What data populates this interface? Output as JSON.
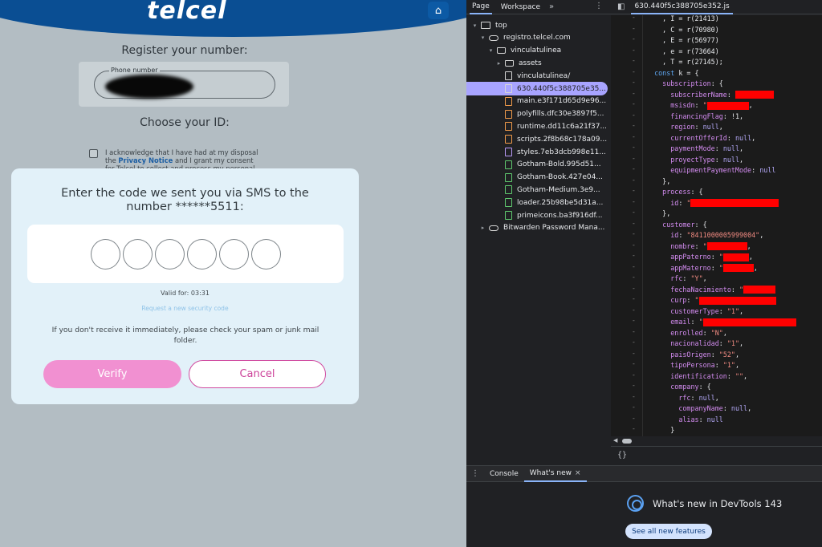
{
  "site": {
    "logo": "telcel",
    "home_icon": "home-icon",
    "register_title": "Register your number:",
    "phone_label": "Phone number",
    "choose_id": "Choose your ID:",
    "consent_pre": "I acknowledge that I have had at my disposal the ",
    "consent_link": "Privacy Notice",
    "consent_post": " and I grant my consent for Telcel to collect and process my personal data",
    "modal": {
      "title": "Enter the code we sent you via SMS to the number ******5511:",
      "digits": [
        "",
        "",
        "",
        "",
        "",
        ""
      ],
      "valid_for": "Valid for: 03:31",
      "request_link": "Request a new security code",
      "spam_note": "If you don't receive it immediately, please check your spam or junk mail folder.",
      "verify_label": "Verify",
      "cancel_label": "Cancel"
    }
  },
  "devtools": {
    "nav_tabs": [
      "Page",
      "Workspace"
    ],
    "nav_more": "»",
    "file_tree": [
      {
        "label": "top",
        "icon": "frame-icon",
        "arrow": "▾",
        "indent": 0
      },
      {
        "label": "registro.telcel.com",
        "icon": "cloud-icon",
        "arrow": "▾",
        "indent": 1
      },
      {
        "label": "vinculatulinea",
        "icon": "folder-icon",
        "arrow": "▾",
        "indent": 2
      },
      {
        "label": "assets",
        "icon": "folder-icon",
        "arrow": "▸",
        "indent": 3
      },
      {
        "label": "vinculatulinea/",
        "icon": "file-icon",
        "arrow": "",
        "indent": 3
      },
      {
        "label": "630.440f5c388705e35...",
        "icon": "file-icon",
        "arrow": "",
        "indent": 3,
        "selected": true
      },
      {
        "label": "main.e3f171d65d9e96...",
        "icon": "js-file-icon",
        "arrow": "",
        "indent": 3
      },
      {
        "label": "polyfills.dfc30e3897f5...",
        "icon": "js-file-icon",
        "arrow": "",
        "indent": 3
      },
      {
        "label": "runtime.dd11c6a21f37...",
        "icon": "js-file-icon",
        "arrow": "",
        "indent": 3
      },
      {
        "label": "scripts.2f8b68c178a09...",
        "icon": "js-file-icon",
        "arrow": "",
        "indent": 3
      },
      {
        "label": "styles.7eb3dcb998e11...",
        "icon": "css-file-icon",
        "arrow": "",
        "indent": 3
      },
      {
        "label": "Gotham-Bold.995d51...",
        "icon": "font-file-icon",
        "arrow": "",
        "indent": 3
      },
      {
        "label": "Gotham-Book.427e04...",
        "icon": "font-file-icon",
        "arrow": "",
        "indent": 3
      },
      {
        "label": "Gotham-Medium.3e9...",
        "icon": "font-file-icon",
        "arrow": "",
        "indent": 3
      },
      {
        "label": "loader.25b98be5d31a...",
        "icon": "font-file-icon",
        "arrow": "",
        "indent": 3
      },
      {
        "label": "primeicons.ba3f916df...",
        "icon": "font-file-icon",
        "arrow": "",
        "indent": 3
      },
      {
        "label": "Bitwarden Password Mana...",
        "icon": "cloud-icon",
        "arrow": "▸",
        "indent": 1
      }
    ],
    "file_tab": "630.440f5c388705e352.js",
    "code_lines": [
      [
        {
          "c": "p",
          "t": "    , I = r(21413)"
        }
      ],
      [
        {
          "c": "p",
          "t": "    , C = r(70980)"
        }
      ],
      [
        {
          "c": "p",
          "t": "    , E = r(56977)"
        }
      ],
      [
        {
          "c": "p",
          "t": "    , e = r(73664)"
        }
      ],
      [
        {
          "c": "p",
          "t": "    , T = r(27145);"
        }
      ],
      [
        {
          "c": "kw",
          "t": "  const "
        },
        {
          "c": "p",
          "t": "k = {"
        }
      ],
      [
        {
          "c": "k",
          "t": "    subscription"
        },
        {
          "c": "p",
          "t": ": {"
        }
      ],
      [
        {
          "c": "k",
          "t": "      subscriberName"
        },
        {
          "c": "p",
          "t": ": "
        },
        {
          "c": "r",
          "w": 48
        }
      ],
      [
        {
          "c": "k",
          "t": "      msisdn"
        },
        {
          "c": "p",
          "t": ": "
        },
        {
          "c": "s",
          "t": "\""
        },
        {
          "c": "r",
          "w": 52
        },
        {
          "c": "p",
          "t": ","
        }
      ],
      [
        {
          "c": "k",
          "t": "      financingFlag"
        },
        {
          "c": "p",
          "t": ": !1,"
        }
      ],
      [
        {
          "c": "k",
          "t": "      region"
        },
        {
          "c": "p",
          "t": ": "
        },
        {
          "c": "n",
          "t": "null"
        },
        {
          "c": "p",
          "t": ","
        }
      ],
      [
        {
          "c": "k",
          "t": "      currentOfferId"
        },
        {
          "c": "p",
          "t": ": "
        },
        {
          "c": "n",
          "t": "null"
        },
        {
          "c": "p",
          "t": ","
        }
      ],
      [
        {
          "c": "k",
          "t": "      paymentMode"
        },
        {
          "c": "p",
          "t": ": "
        },
        {
          "c": "n",
          "t": "null"
        },
        {
          "c": "p",
          "t": ","
        }
      ],
      [
        {
          "c": "k",
          "t": "      proyectType"
        },
        {
          "c": "p",
          "t": ": "
        },
        {
          "c": "n",
          "t": "null"
        },
        {
          "c": "p",
          "t": ","
        }
      ],
      [
        {
          "c": "k",
          "t": "      equipmentPaymentMode"
        },
        {
          "c": "p",
          "t": ": "
        },
        {
          "c": "n",
          "t": "null"
        }
      ],
      [
        {
          "c": "p",
          "t": "    },"
        }
      ],
      [
        {
          "c": "k",
          "t": "    process"
        },
        {
          "c": "p",
          "t": ": {"
        }
      ],
      [
        {
          "c": "k",
          "t": "      id"
        },
        {
          "c": "p",
          "t": ": "
        },
        {
          "c": "s",
          "t": "\""
        },
        {
          "c": "r",
          "w": 110
        }
      ],
      [
        {
          "c": "p",
          "t": "    },"
        }
      ],
      [
        {
          "c": "k",
          "t": "    customer"
        },
        {
          "c": "p",
          "t": ": {"
        }
      ],
      [
        {
          "c": "k",
          "t": "      id"
        },
        {
          "c": "p",
          "t": ": "
        },
        {
          "c": "s",
          "t": "\"8411000005999004\""
        },
        {
          "c": "p",
          "t": ","
        }
      ],
      [
        {
          "c": "k",
          "t": "      nombre"
        },
        {
          "c": "p",
          "t": ": "
        },
        {
          "c": "s",
          "t": "\""
        },
        {
          "c": "r",
          "w": 50
        },
        {
          "c": "p",
          "t": ","
        }
      ],
      [
        {
          "c": "k",
          "t": "      appPaterno"
        },
        {
          "c": "p",
          "t": ": "
        },
        {
          "c": "s",
          "t": "\""
        },
        {
          "c": "r",
          "w": 32
        },
        {
          "c": "p",
          "t": ","
        }
      ],
      [
        {
          "c": "k",
          "t": "      appMaterno"
        },
        {
          "c": "p",
          "t": ": "
        },
        {
          "c": "s",
          "t": "\""
        },
        {
          "c": "r",
          "w": 38
        },
        {
          "c": "p",
          "t": ","
        }
      ],
      [
        {
          "c": "k",
          "t": "      rfc"
        },
        {
          "c": "p",
          "t": ": "
        },
        {
          "c": "s",
          "t": "\"Y\""
        },
        {
          "c": "p",
          "t": ","
        }
      ],
      [
        {
          "c": "k",
          "t": "      fechaNacimiento"
        },
        {
          "c": "p",
          "t": ": "
        },
        {
          "c": "s",
          "t": "\""
        },
        {
          "c": "r",
          "w": 40
        }
      ],
      [
        {
          "c": "k",
          "t": "      curp"
        },
        {
          "c": "p",
          "t": ": "
        },
        {
          "c": "s",
          "t": "\""
        },
        {
          "c": "r",
          "w": 96
        }
      ],
      [
        {
          "c": "k",
          "t": "      customerType"
        },
        {
          "c": "p",
          "t": ": "
        },
        {
          "c": "s",
          "t": "\"1\""
        },
        {
          "c": "p",
          "t": ","
        }
      ],
      [
        {
          "c": "k",
          "t": "      email"
        },
        {
          "c": "p",
          "t": ": "
        },
        {
          "c": "s",
          "t": "\""
        },
        {
          "c": "r",
          "w": 116
        }
      ],
      [
        {
          "c": "k",
          "t": "      enrolled"
        },
        {
          "c": "p",
          "t": ": "
        },
        {
          "c": "s",
          "t": "\"N\""
        },
        {
          "c": "p",
          "t": ","
        }
      ],
      [
        {
          "c": "k",
          "t": "      nacionalidad"
        },
        {
          "c": "p",
          "t": ": "
        },
        {
          "c": "s",
          "t": "\"1\""
        },
        {
          "c": "p",
          "t": ","
        }
      ],
      [
        {
          "c": "k",
          "t": "      paisOrigen"
        },
        {
          "c": "p",
          "t": ": "
        },
        {
          "c": "s",
          "t": "\"52\""
        },
        {
          "c": "p",
          "t": ","
        }
      ],
      [
        {
          "c": "k",
          "t": "      tipoPersona"
        },
        {
          "c": "p",
          "t": ": "
        },
        {
          "c": "s",
          "t": "\"1\""
        },
        {
          "c": "p",
          "t": ","
        }
      ],
      [
        {
          "c": "k",
          "t": "      identification"
        },
        {
          "c": "p",
          "t": ": "
        },
        {
          "c": "s",
          "t": "\"\""
        },
        {
          "c": "p",
          "t": ","
        }
      ],
      [
        {
          "c": "k",
          "t": "      company"
        },
        {
          "c": "p",
          "t": ": {"
        }
      ],
      [
        {
          "c": "k",
          "t": "        rfc"
        },
        {
          "c": "p",
          "t": ": "
        },
        {
          "c": "n",
          "t": "null"
        },
        {
          "c": "p",
          "t": ","
        }
      ],
      [
        {
          "c": "k",
          "t": "        companyName"
        },
        {
          "c": "p",
          "t": ": "
        },
        {
          "c": "n",
          "t": "null"
        },
        {
          "c": "p",
          "t": ","
        }
      ],
      [
        {
          "c": "k",
          "t": "        alias"
        },
        {
          "c": "p",
          "t": ": "
        },
        {
          "c": "n",
          "t": "null"
        }
      ],
      [
        {
          "c": "p",
          "t": "      }"
        }
      ]
    ],
    "pretty_print": "{}",
    "drawer_tabs": [
      {
        "label": "Console",
        "active": false
      },
      {
        "label": "What's new",
        "active": true
      }
    ],
    "close_glyph": "×",
    "whats_new_title": "What's new in DevTools 143",
    "whats_new_button": "See all new features"
  },
  "colors": {
    "telcel_blue": "#0a4e93",
    "verify_pink": "#f190d1",
    "cancel_pink": "#cc3f98",
    "devtools_bg": "#202124",
    "selection": "#a8a4ff",
    "redaction": "#ff0000"
  }
}
